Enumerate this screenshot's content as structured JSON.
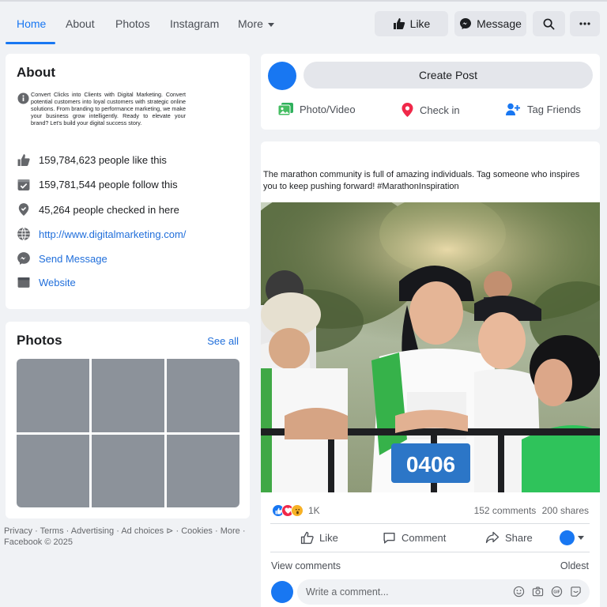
{
  "nav": {
    "tabs": [
      "Home",
      "About",
      "Photos",
      "Instagram",
      "More"
    ],
    "like_label": "Like",
    "message_label": "Message"
  },
  "about": {
    "title": "About",
    "description": "Convert Clicks into Clients with Digital Marketing. Convert potential customers into loyal customers with strategic online solutions. From branding to performance marketing, we make your business grow intelligently. Ready to elevate your brand? Let's build your digital success story.",
    "likes": "159,784,623 people like this",
    "follows": "159,781,544 people follow this",
    "checkins": "45,264 people checked in here",
    "website_url": "http://www.digitalmarketing.com/",
    "send_message": "Send Message",
    "website": "Website"
  },
  "photos": {
    "title": "Photos",
    "see_all": "See all"
  },
  "footer": {
    "text": "Privacy · Terms · Advertising · Ad choices ⊳ · Cookies · More · Facebook © 2025"
  },
  "create_post": {
    "button": "Create Post",
    "photo_video": "Photo/Video",
    "check_in": "Check in",
    "tag_friends": "Tag Friends"
  },
  "post": {
    "text": "The marathon community is full of amazing individuals. Tag someone who inspires you to keep pushing forward! #MarathonInspiration",
    "bib_number": "0406",
    "reaction_count": "1K",
    "comments": "152 comments",
    "shares": "200 shares",
    "like": "Like",
    "comment": "Comment",
    "share": "Share",
    "view_comments": "View comments",
    "oldest": "Oldest",
    "comment_placeholder": "Write a comment..."
  },
  "colors": {
    "accent": "#1877f2",
    "link": "#216fdb",
    "photo_placeholder": "#8c929a",
    "background": "#f0f2f5"
  }
}
